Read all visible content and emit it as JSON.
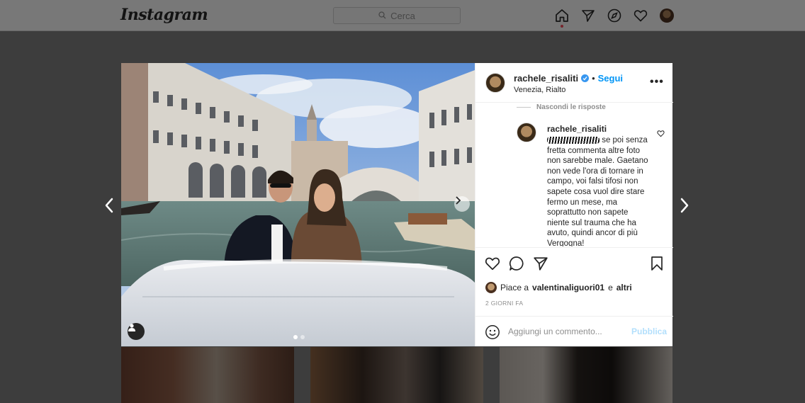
{
  "nav": {
    "logo": "Instagram",
    "search_placeholder": "Cerca",
    "icons": [
      "home-icon",
      "direct-icon",
      "explore-icon",
      "activity-heart-icon",
      "profile-avatar"
    ]
  },
  "post": {
    "username": "rachele_risaliti",
    "verified": true,
    "separator": "•",
    "follow_label": "Segui",
    "location": "Venezia, Rialto",
    "more_label": "•••",
    "hide_replies_label": "Nascondi le risposte",
    "comment": {
      "username": "rachele_risaliti",
      "text_after_mention": " se poi senza fretta commenta altre foto non sarebbe male. Gaetano non vede l'ora di tornare in campo, voi falsi tifosi non sapete cosa vuol dire stare fermo un mese, ma soprattutto non sapete niente sul trauma che ha avuto, quindi ancor di più Vergogna!"
    },
    "likes": {
      "prefix": "Piace a",
      "user": "valentinaliguori01",
      "conjunction": "e",
      "others": "altri"
    },
    "time": "2 GIORNI FA",
    "add_comment_placeholder": "Aggiungi un commento...",
    "publish_label": "Pubblica"
  },
  "colors": {
    "accent": "#0095f6",
    "publish_disabled": "#b2dffc",
    "verified": "#3897f0",
    "notification_dot": "#ed4956"
  }
}
